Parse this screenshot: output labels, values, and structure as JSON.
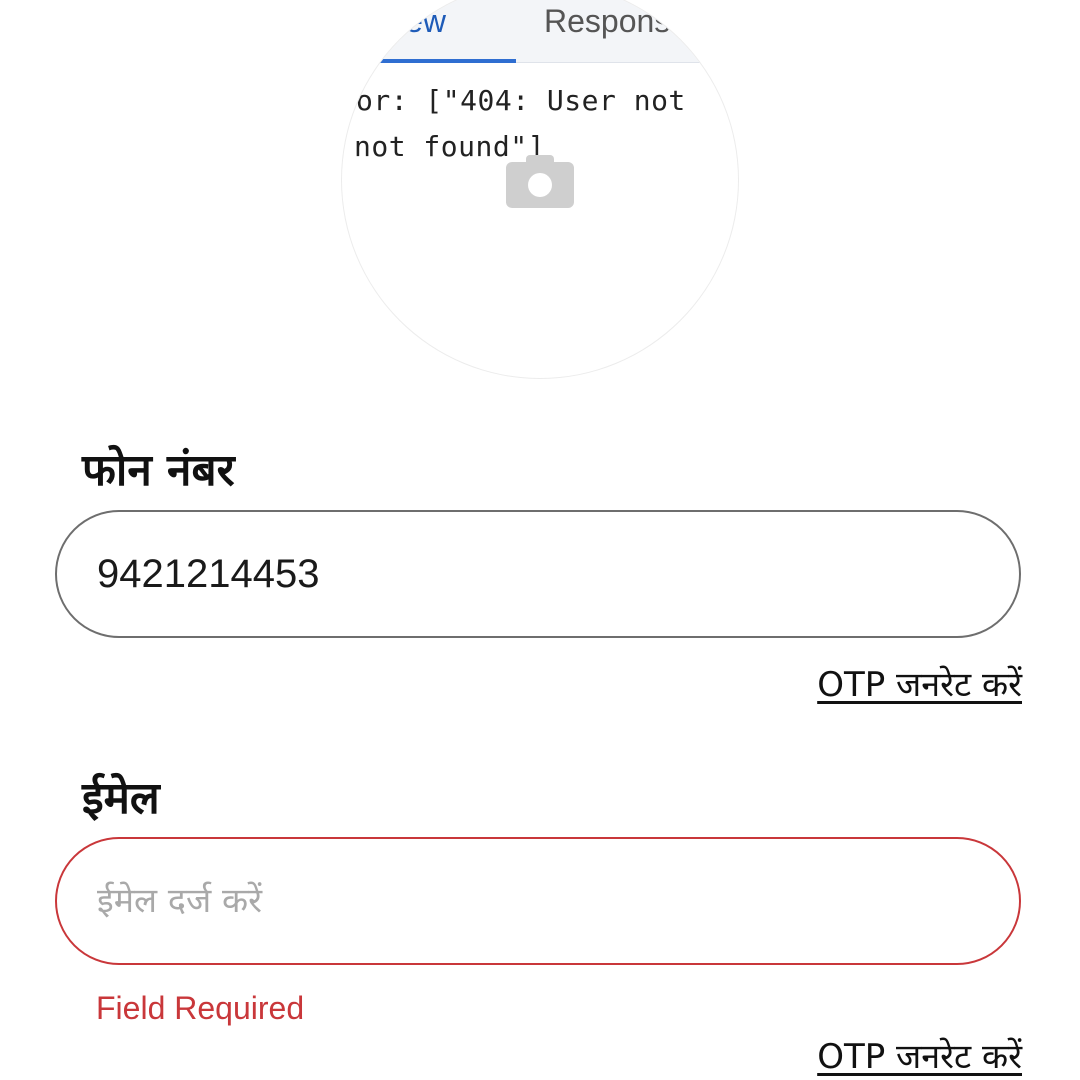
{
  "profile_photo": {
    "tabs": [
      "view",
      "Respons"
    ],
    "code_lines": [
      "or: [\"404: User not",
      "not found\"]"
    ],
    "camera_icon": "camera-icon"
  },
  "phone": {
    "label": "फोन नंबर",
    "value": "9421214453",
    "otp_link": "OTP जनरेट करें"
  },
  "email": {
    "label": "ईमेल",
    "value": "",
    "placeholder": "ईमेल दर्ज करें",
    "error": "Field Required",
    "otp_link": "OTP जनरेट करें"
  },
  "colors": {
    "error": "#c9373a",
    "field_border": "#6e6e6e",
    "text": "#111111",
    "placeholder": "#a9a9a9"
  }
}
